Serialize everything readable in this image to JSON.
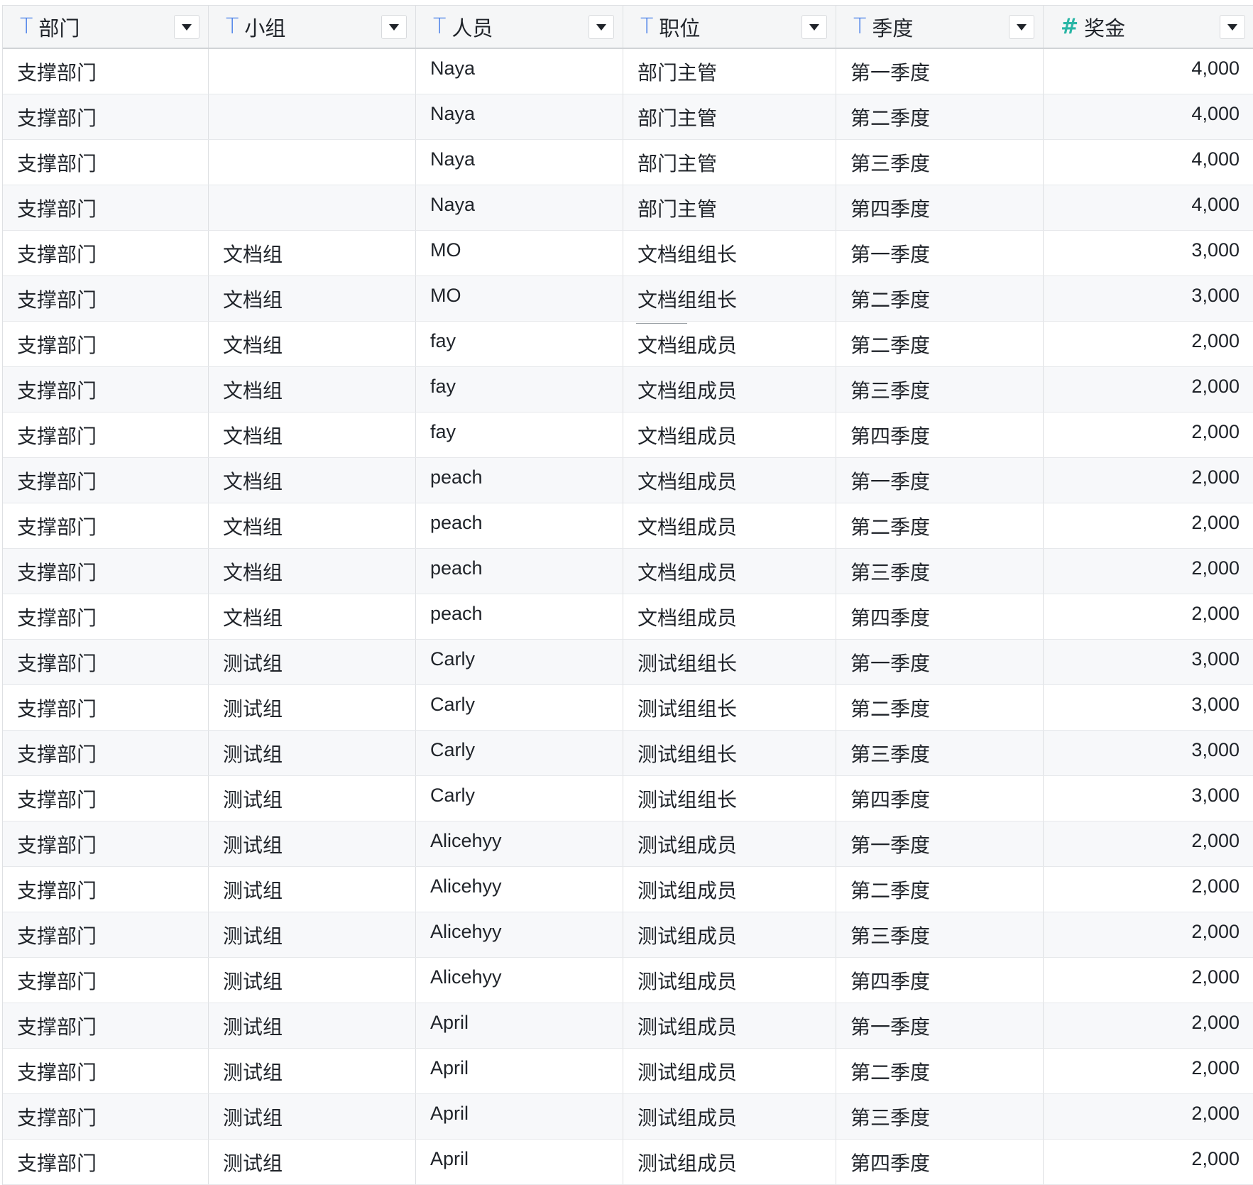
{
  "columns": [
    {
      "type_icon": "T",
      "label": "部门"
    },
    {
      "type_icon": "T",
      "label": "小组"
    },
    {
      "type_icon": "T",
      "label": "人员"
    },
    {
      "type_icon": "T",
      "label": "职位"
    },
    {
      "type_icon": "T",
      "label": "季度"
    },
    {
      "type_icon": "#",
      "label": "奖金"
    }
  ],
  "rows": [
    [
      "支撑部门",
      "",
      "Naya",
      "部门主管",
      "第一季度",
      "4,000"
    ],
    [
      "支撑部门",
      "",
      "Naya",
      "部门主管",
      "第二季度",
      "4,000"
    ],
    [
      "支撑部门",
      "",
      "Naya",
      "部门主管",
      "第三季度",
      "4,000"
    ],
    [
      "支撑部门",
      "",
      "Naya",
      "部门主管",
      "第四季度",
      "4,000"
    ],
    [
      "支撑部门",
      "文档组",
      "MO",
      "文档组组长",
      "第一季度",
      "3,000"
    ],
    [
      "支撑部门",
      "文档组",
      "MO",
      "文档组组长",
      "第二季度",
      "3,000"
    ],
    [
      "支撑部门",
      "文档组",
      "fay",
      "文档组成员",
      "第二季度",
      "2,000"
    ],
    [
      "支撑部门",
      "文档组",
      "fay",
      "文档组成员",
      "第三季度",
      "2,000"
    ],
    [
      "支撑部门",
      "文档组",
      "fay",
      "文档组成员",
      "第四季度",
      "2,000"
    ],
    [
      "支撑部门",
      "文档组",
      "peach",
      "文档组成员",
      "第一季度",
      "2,000"
    ],
    [
      "支撑部门",
      "文档组",
      "peach",
      "文档组成员",
      "第二季度",
      "2,000"
    ],
    [
      "支撑部门",
      "文档组",
      "peach",
      "文档组成员",
      "第三季度",
      "2,000"
    ],
    [
      "支撑部门",
      "文档组",
      "peach",
      "文档组成员",
      "第四季度",
      "2,000"
    ],
    [
      "支撑部门",
      "测试组",
      "Carly",
      "测试组组长",
      "第一季度",
      "3,000"
    ],
    [
      "支撑部门",
      "测试组",
      "Carly",
      "测试组组长",
      "第二季度",
      "3,000"
    ],
    [
      "支撑部门",
      "测试组",
      "Carly",
      "测试组组长",
      "第三季度",
      "3,000"
    ],
    [
      "支撑部门",
      "测试组",
      "Carly",
      "测试组组长",
      "第四季度",
      "3,000"
    ],
    [
      "支撑部门",
      "测试组",
      "Alicehyy",
      "测试组成员",
      "第一季度",
      "2,000"
    ],
    [
      "支撑部门",
      "测试组",
      "Alicehyy",
      "测试组成员",
      "第二季度",
      "2,000"
    ],
    [
      "支撑部门",
      "测试组",
      "Alicehyy",
      "测试组成员",
      "第三季度",
      "2,000"
    ],
    [
      "支撑部门",
      "测试组",
      "Alicehyy",
      "测试组成员",
      "第四季度",
      "2,000"
    ],
    [
      "支撑部门",
      "测试组",
      "April",
      "测试组成员",
      "第一季度",
      "2,000"
    ],
    [
      "支撑部门",
      "测试组",
      "April",
      "测试组成员",
      "第二季度",
      "2,000"
    ],
    [
      "支撑部门",
      "测试组",
      "April",
      "测试组成员",
      "第三季度",
      "2,000"
    ],
    [
      "支撑部门",
      "测试组",
      "April",
      "测试组成员",
      "第四季度",
      "2,000"
    ]
  ],
  "icons": {
    "text_type": "text-type-icon",
    "number_type": "number-type-icon",
    "dropdown": "chevron-down-icon"
  },
  "colors": {
    "text_type_icon": "#4e83e8",
    "number_type_icon": "#2bb6a6",
    "header_bg": "#f5f6f7",
    "stripe_bg": "#f7f8fa"
  }
}
